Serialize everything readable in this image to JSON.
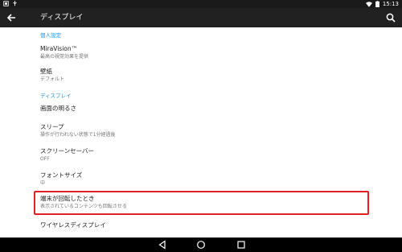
{
  "status_bar": {
    "time": "15:13",
    "icons": [
      "screenshot-icon",
      "usb-icon",
      "wifi-icon",
      "battery-icon"
    ]
  },
  "app_bar": {
    "title": "ディスプレイ",
    "back_icon": "back-arrow-icon",
    "search_icon": "search-icon"
  },
  "sections": [
    {
      "header": "個人設定",
      "items": [
        {
          "title": "MiraVision™",
          "summary": "最高の視覚効果を提供"
        },
        {
          "title": "壁紙",
          "summary": "デフォルト"
        }
      ]
    },
    {
      "header": "ディスプレイ",
      "items": [
        {
          "title": "画面の明るさ",
          "summary": ""
        },
        {
          "title": "スリープ",
          "summary": "操作が行われない状態で1分経過後"
        },
        {
          "title": "スクリーンセーバー",
          "summary": "OFF"
        },
        {
          "title": "フォントサイズ",
          "summary": "中"
        },
        {
          "title": "端末が回転したとき",
          "summary": "表示されているコンテンツも回転させる"
        },
        {
          "title": "ワイヤレスディスプレイ",
          "summary": ""
        }
      ]
    }
  ],
  "highlight_color": "#e02020",
  "nav_bar": {
    "buttons": [
      "back-triangle-icon",
      "home-circle-icon",
      "recents-square-icon"
    ]
  }
}
